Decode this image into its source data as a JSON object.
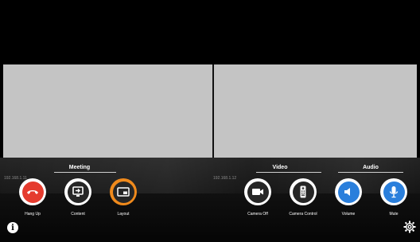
{
  "participants": {
    "left_id": "192.168.1.11",
    "right_id": "192.168.1.12"
  },
  "groups": {
    "meeting": "Meeting",
    "video": "Video",
    "audio": "Audio"
  },
  "controls": {
    "hang_up": "Hang Up",
    "content": "Content",
    "layout": "Layout",
    "camera_off": "Camera Off",
    "camera_control": "Camera Control",
    "volume": "Volume",
    "mute": "Mute"
  },
  "icons": {
    "hang_up": "phone-hangup-icon",
    "content": "share-content-icon",
    "layout": "picture-in-picture-icon",
    "camera_off": "video-camera-icon",
    "camera_control": "remote-control-icon",
    "volume": "speaker-icon",
    "mute": "microphone-icon",
    "info": "info-icon",
    "settings": "gear-icon"
  },
  "colors": {
    "hang_up_red": "#e53b2e",
    "layout_ring_orange": "#f08a1c",
    "audio_blue": "#2a7fdc",
    "tile_gray": "#c4c4c4"
  }
}
